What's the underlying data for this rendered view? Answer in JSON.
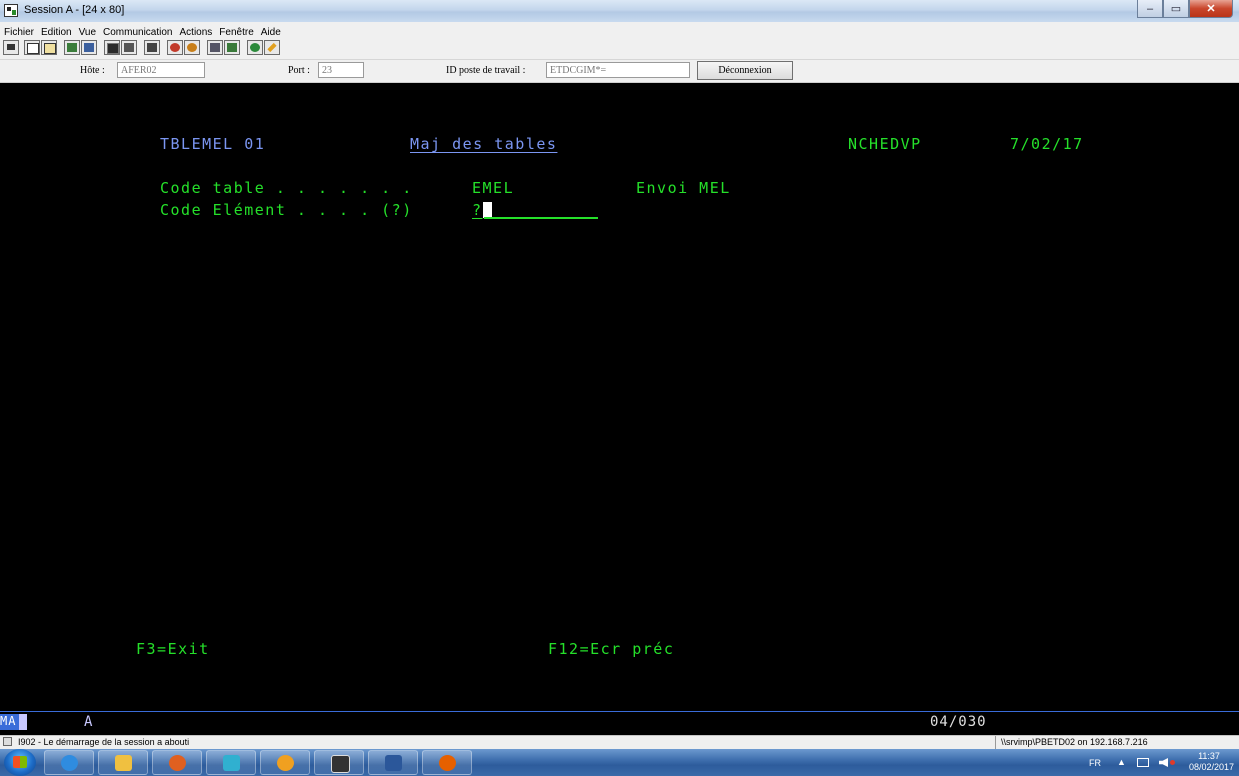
{
  "window": {
    "title": "Session A - [24 x 80]",
    "buttons": {
      "minimize": "‒",
      "maximize": "▭",
      "close": "✕"
    }
  },
  "menu": [
    "Fichier",
    "Edition",
    "Vue",
    "Communication",
    "Actions",
    "Fenêtre",
    "Aide"
  ],
  "toolbar_icons": [
    "print-screen-icon",
    "copy-icon",
    "paste-icon",
    "send-file-icon",
    "receive-file-icon",
    "display-icon",
    "keyboard-icon",
    "print-icon",
    "macro-record-icon",
    "macro-play-icon",
    "customize-icon",
    "settings-icon",
    "web-icon",
    "edit-icon"
  ],
  "connection": {
    "host_label": "Hôte :",
    "host_value": "AFER02",
    "port_label": "Port :",
    "port_value": "23",
    "workstation_label": "ID poste de travail :",
    "workstation_value": "ETDCGIM*=",
    "disconnect_label": "Déconnexion"
  },
  "screen": {
    "program_id": "TBLEMEL 01",
    "title": "Maj des tables",
    "user": "NCHEDVP",
    "date": "7/02/17",
    "code_table_label": "Code table . . . . . . .",
    "code_table_value": "EMEL",
    "code_table_desc": "Envoi MEL",
    "code_element_label": "Code Elément . . . . (?)",
    "code_element_value": "?",
    "f3": "F3=Exit",
    "f12": "F12=Ecr préc"
  },
  "oia": {
    "mode": "MA",
    "indicator": "A",
    "cursor_position": "04/030"
  },
  "status": {
    "message": "I902 - Le démarrage de la session a abouti",
    "connection": "\\\\srvimp\\PBETD02 on 192.168.7.216"
  },
  "taskbar": {
    "apps": [
      "internet-explorer-icon",
      "file-explorer-icon",
      "media-player-icon",
      "network-app-icon",
      "app-icon",
      "terminal-emulator-icon",
      "word-icon",
      "firefox-icon"
    ],
    "language": "FR",
    "tray_arrow": "▲",
    "time": "11:37",
    "date": "08/02/2017"
  },
  "colors": {
    "screen_bg": "#000000",
    "field_green": "#25e02a",
    "header_blue": "#7b96f2"
  }
}
